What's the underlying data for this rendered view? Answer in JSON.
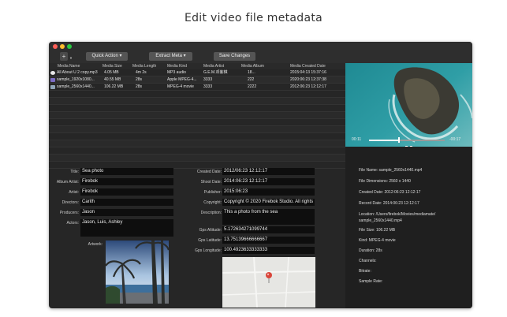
{
  "caption": "Edit video file metadata",
  "window": {
    "traffic_colors": [
      "#ff5f57",
      "#febc2e",
      "#28c840"
    ]
  },
  "toolbar": {
    "plus_label": "+",
    "quick_action": "Quick Action",
    "extract_meta": "Extract Meta",
    "save_changes": "Save Changes",
    "dropdown_glyph": "▾"
  },
  "table": {
    "columns": [
      "Media Name",
      "Media Size",
      "Media Length",
      "Media Kind",
      "Media Artist",
      "Media Album",
      "Media Created Date"
    ],
    "rows": [
      {
        "name": "All About U 2 copy.mp3",
        "size": "4.05 MB",
        "length": "4m 2s",
        "kind": "MP3 audio",
        "artist": "G.E.M.邓紫棋",
        "album": "18...",
        "created": "2015:04:13 15:37:16"
      },
      {
        "name": "sample_1920x1080...",
        "size": "40.55 MB",
        "length": "28s",
        "kind": "Apple MPEG-4...",
        "artist": "3333",
        "album": "222",
        "created": "2020:06:23 12:37:38"
      },
      {
        "name": "sample_2560x1440...",
        "size": "106.22 MB",
        "length": "28s",
        "kind": "MPEG-4 movie",
        "artist": "3333",
        "album": "2222",
        "created": "2012:06:23 12:12:17"
      }
    ]
  },
  "player": {
    "elapsed": "00:11",
    "remaining": "-00:17",
    "progress": 0.39
  },
  "meta_left": {
    "title_label": "Title:",
    "title": "Sea photo",
    "album_artist_label": "Album Artist:",
    "album_artist": "Firebok",
    "artist_label": "Artist:",
    "artist": "Firebok",
    "directors_label": "Directors:",
    "directors": "Carith",
    "producers_label": "Producers:",
    "producers": "Jason",
    "actors_label": "Actors:",
    "actors": "Jason, Luis, Ashley",
    "artwork_label": "Artwork:"
  },
  "meta_right": {
    "created_label": "Created Date:",
    "created": "2012/06:23 12:12:17",
    "shoot_label": "Shoot Date:",
    "shoot": "2014:06:23 12:12:17",
    "publisher_label": "Publisher:",
    "publisher": "2015:06:23",
    "copyright_label": "Copyright:",
    "copyright": "Copyright © 2020 Firebok Studio. All rights",
    "description_label": "Description:",
    "description": "This a photo from the sea",
    "altitude_label": "Gps Altitude:",
    "altitude": "5.172634271099744",
    "latitude_label": "Gps Latitude:",
    "latitude": "13.75139666666667",
    "longitude_label": "Gps Longitude:",
    "longitude": "100.4923633333333"
  },
  "file_info": [
    "File Name: sample_2560x1440.mp4",
    "File Dimensions: 2560 x 1440",
    "Created Date: 2012:06:23 12:12:17",
    "Record Date: 2014:06:23 12:12:17",
    "Location: /Users/firebok/Movies/mediamate/",
    "sample_2560x1440.mp4",
    "File Size: 106.22 MB",
    "Kind: MPEG-4 movie",
    "Duration: 28s",
    "Channels:",
    "Bitrate:",
    "Sample Rate:"
  ]
}
